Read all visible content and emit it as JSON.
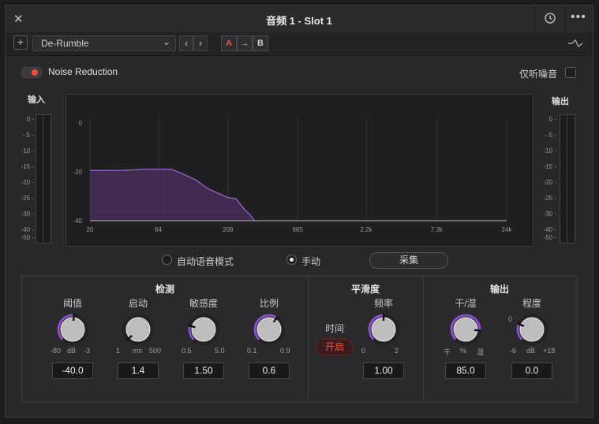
{
  "window": {
    "title": "音频 1 - Slot 1"
  },
  "toolbar": {
    "preset": "De-Rumble",
    "prev": "‹",
    "next": "›",
    "a": "A",
    "arrow": "→",
    "b": "B",
    "add": "+"
  },
  "header": {
    "noise_reduction": "Noise Reduction",
    "listen_only": "仅听噪音"
  },
  "meters": {
    "input_title": "输入",
    "output_title": "输出",
    "ticks": [
      "0",
      "- 5",
      "-10",
      "-15",
      "-20",
      "-25",
      "-30",
      "-40",
      "-50"
    ]
  },
  "graph": {
    "y_ticks": [
      "0",
      "-20",
      "-40"
    ],
    "x_ticks": [
      "20",
      "64",
      "209",
      "685",
      "2.2k",
      "7.3k",
      "24k"
    ]
  },
  "chart_data": {
    "type": "area",
    "x": [
      20,
      35,
      55,
      64,
      80,
      95,
      120,
      150,
      209,
      240,
      280,
      300,
      330
    ],
    "y": [
      -19.5,
      -19.4,
      -18.9,
      -18.9,
      -19.0,
      -20.6,
      -23.2,
      -27.0,
      -30.5,
      -31.0,
      -35.7,
      -37.2,
      -40
    ],
    "x_scale": "log",
    "xlim": [
      20,
      24000
    ],
    "ylim": [
      -40,
      0
    ],
    "x_ticks": [
      "20",
      "64",
      "209",
      "685",
      "2.2k",
      "7.3k",
      "24k"
    ],
    "y_ticks": [
      "0",
      "-20",
      "-40"
    ],
    "fill_color": "#4a2e5e",
    "line_color": "#9a6ad0"
  },
  "mode": {
    "auto": "自动语音模式",
    "manual": "手动",
    "capture": "采集"
  },
  "sections": {
    "detect": {
      "title": "检测"
    },
    "smooth": {
      "title": "平滑度",
      "time_label": "时间",
      "time_toggle": "开启"
    },
    "output": {
      "title": "输出"
    }
  },
  "knobs": [
    {
      "label": "阈值",
      "min": "-80",
      "unit": "dB",
      "max": "-3",
      "value": "-40.0",
      "level": 0.52
    },
    {
      "label": "启动",
      "min": "1",
      "unit": "ms",
      "max": "500",
      "value": "1.4",
      "level": 0.0
    },
    {
      "label": "敏感度",
      "min": "0.5",
      "unit": "",
      "max": "5.0",
      "value": "1.50",
      "level": 0.22
    },
    {
      "label": "比例",
      "min": "0.1",
      "unit": "",
      "max": "0.9",
      "value": "0.6",
      "level": 0.62
    },
    {
      "label": "频率",
      "min": "0",
      "unit": "",
      "max": "2",
      "value": "1.00",
      "level": 0.5
    },
    {
      "label": "干/湿",
      "min": "干",
      "unit": "%",
      "max": "湿",
      "value": "85.0",
      "level": 0.85
    },
    {
      "label": "程度",
      "min": "-6",
      "unit": "dB",
      "max": "+18",
      "value": "0.0",
      "level": 0.25,
      "extra": "0"
    }
  ],
  "colors": {
    "accent": "#8a4fd0",
    "alert": "#ff4a3a"
  }
}
